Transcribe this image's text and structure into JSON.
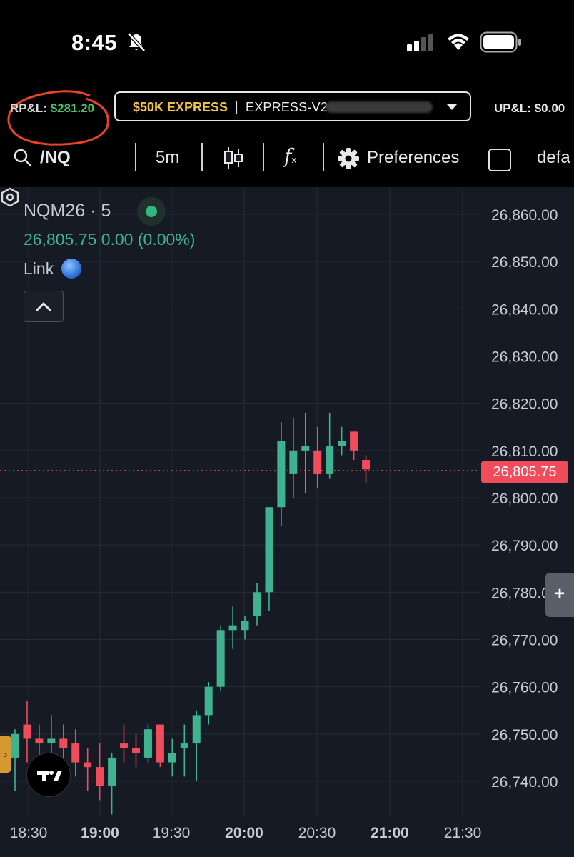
{
  "status_bar": {
    "time": "8:45"
  },
  "account_bar": {
    "rpl_label": "RP&L:",
    "rpl_value": "$281.20",
    "account_badge": "$50K EXPRESS",
    "separator": "|",
    "account_id": "EXPRESS-V2-",
    "upl_label": "UP&L:",
    "upl_value": "$0.00"
  },
  "toolbar": {
    "symbol": "/NQ",
    "interval": "5m",
    "fx_label": "f",
    "fx_sub": "x",
    "preferences_label": "Preferences",
    "default_label": "defa"
  },
  "legend": {
    "symbol": "NQM26 · 5",
    "price_line": "26,805.75  0.00 (0.00%)",
    "link_label": "Link"
  },
  "colors": {
    "background": "#161a25",
    "up": "#3fb390",
    "down": "#f04c5b",
    "grid": "#262a35",
    "accent_gold": "#f0c24a"
  },
  "chart_data": {
    "type": "candlestick",
    "symbol": "NQM26",
    "interval": "5m",
    "last_price": 26805.75,
    "last_price_label": "26,805.75",
    "ylim": [
      26734,
      26867
    ],
    "y_ticks": [
      26740,
      26750,
      26760,
      26770,
      26780,
      26790,
      26800,
      26810,
      26820,
      26830,
      26840,
      26850,
      26860
    ],
    "y_tick_labels": [
      "26,740.00",
      "26,750.00",
      "26,760.00",
      "26,770.00",
      "26,780.00",
      "26,790.00",
      "26,800.00",
      "26,810.00",
      "26,820.00",
      "26,830.00",
      "26,840.00",
      "26,850.00",
      "26,860.00"
    ],
    "x_tick_labels": [
      {
        "label": "18:30",
        "bold": false
      },
      {
        "label": "19:00",
        "bold": true
      },
      {
        "label": "19:30",
        "bold": false
      },
      {
        "label": "20:00",
        "bold": true
      },
      {
        "label": "20:30",
        "bold": false
      },
      {
        "label": "21:00",
        "bold": true
      },
      {
        "label": "21:30",
        "bold": false
      }
    ],
    "candles": [
      {
        "o": 26745,
        "h": 26751,
        "l": 26738,
        "c": 26750
      },
      {
        "o": 26752,
        "h": 26757,
        "l": 26744,
        "c": 26749
      },
      {
        "o": 26749,
        "h": 26752,
        "l": 26745,
        "c": 26748
      },
      {
        "o": 26748,
        "h": 26754,
        "l": 26742,
        "c": 26749
      },
      {
        "o": 26749,
        "h": 26752,
        "l": 26745,
        "c": 26747
      },
      {
        "o": 26748,
        "h": 26751,
        "l": 26741,
        "c": 26744
      },
      {
        "o": 26744,
        "h": 26747,
        "l": 26738,
        "c": 26743
      },
      {
        "o": 26743,
        "h": 26748,
        "l": 26736,
        "c": 26739
      },
      {
        "o": 26739,
        "h": 26746,
        "l": 26733,
        "c": 26745
      },
      {
        "o": 26748,
        "h": 26752,
        "l": 26744,
        "c": 26747
      },
      {
        "o": 26747,
        "h": 26750,
        "l": 26743,
        "c": 26746
      },
      {
        "o": 26745,
        "h": 26752,
        "l": 26744,
        "c": 26751
      },
      {
        "o": 26752,
        "h": 26752,
        "l": 26743,
        "c": 26744
      },
      {
        "o": 26744,
        "h": 26749,
        "l": 26741,
        "c": 26746
      },
      {
        "o": 26747,
        "h": 26752,
        "l": 26741,
        "c": 26748
      },
      {
        "o": 26748,
        "h": 26755,
        "l": 26740,
        "c": 26754
      },
      {
        "o": 26754,
        "h": 26761,
        "l": 26752,
        "c": 26760
      },
      {
        "o": 26760,
        "h": 26773,
        "l": 26759,
        "c": 26772
      },
      {
        "o": 26772,
        "h": 26777,
        "l": 26768,
        "c": 26773
      },
      {
        "o": 26772,
        "h": 26775,
        "l": 26770,
        "c": 26774
      },
      {
        "o": 26775,
        "h": 26782,
        "l": 26773,
        "c": 26780
      },
      {
        "o": 26780,
        "h": 26798,
        "l": 26776,
        "c": 26798
      },
      {
        "o": 26798,
        "h": 26816,
        "l": 26794,
        "c": 26812
      },
      {
        "o": 26805,
        "h": 26817,
        "l": 26800,
        "c": 26810
      },
      {
        "o": 26810,
        "h": 26818,
        "l": 26801,
        "c": 26811
      },
      {
        "o": 26810,
        "h": 26815,
        "l": 26802,
        "c": 26805
      },
      {
        "o": 26805,
        "h": 26818,
        "l": 26804,
        "c": 26811
      },
      {
        "o": 26811,
        "h": 26815,
        "l": 26809,
        "c": 26812
      },
      {
        "o": 26814,
        "h": 26814,
        "l": 26808,
        "c": 26810
      },
      {
        "o": 26808,
        "h": 26809,
        "l": 26803,
        "c": 26806
      }
    ]
  }
}
